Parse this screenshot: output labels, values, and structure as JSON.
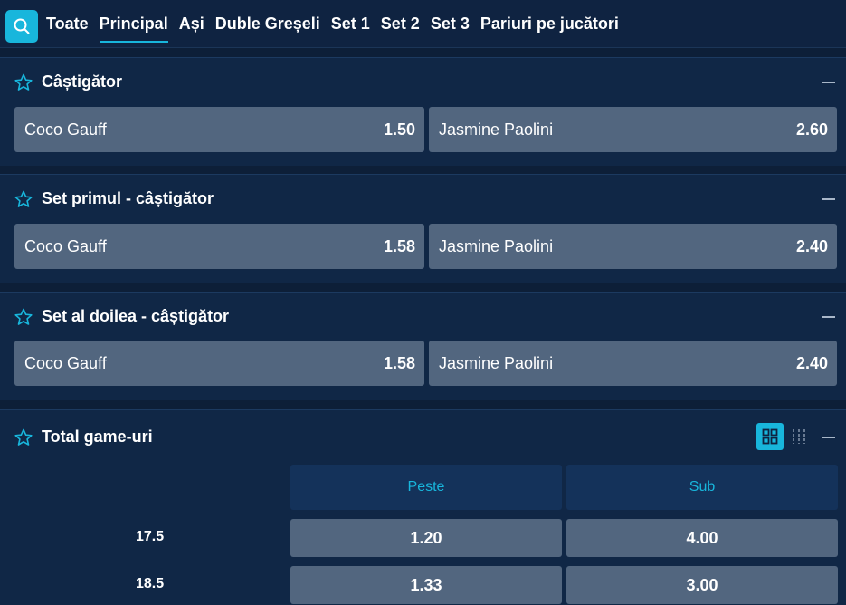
{
  "nav": {
    "tabs": [
      {
        "label": "Toate"
      },
      {
        "label": "Principal"
      },
      {
        "label": "Ași"
      },
      {
        "label": "Duble Greșeli"
      },
      {
        "label": "Set 1"
      },
      {
        "label": "Set 2"
      },
      {
        "label": "Set 3"
      },
      {
        "label": "Pariuri pe jucători"
      }
    ],
    "active_tab": "Principal",
    "icons": {
      "search": "search-icon"
    }
  },
  "markets": [
    {
      "title": "Câștigător",
      "selections": [
        {
          "name": "Coco Gauff",
          "odd": "1.50"
        },
        {
          "name": "Jasmine Paolini",
          "odd": "2.60"
        }
      ]
    },
    {
      "title": "Set primul - câștigător",
      "selections": [
        {
          "name": "Coco Gauff",
          "odd": "1.58"
        },
        {
          "name": "Jasmine Paolini",
          "odd": "2.40"
        }
      ]
    },
    {
      "title": "Set al doilea - câștigător",
      "selections": [
        {
          "name": "Coco Gauff",
          "odd": "1.58"
        },
        {
          "name": "Jasmine Paolini",
          "odd": "2.40"
        }
      ]
    }
  ],
  "totals": {
    "title": "Total game-uri",
    "columns": [
      "Peste",
      "Sub"
    ],
    "rows": [
      {
        "line": "17.5",
        "over": "1.20",
        "under": "4.00"
      },
      {
        "line": "18.5",
        "over": "1.33",
        "under": "3.00"
      }
    ]
  },
  "colors": {
    "accent": "#18b6dc",
    "background": "#0d1f38",
    "card": "#102746",
    "odd_button": "#52667f"
  }
}
